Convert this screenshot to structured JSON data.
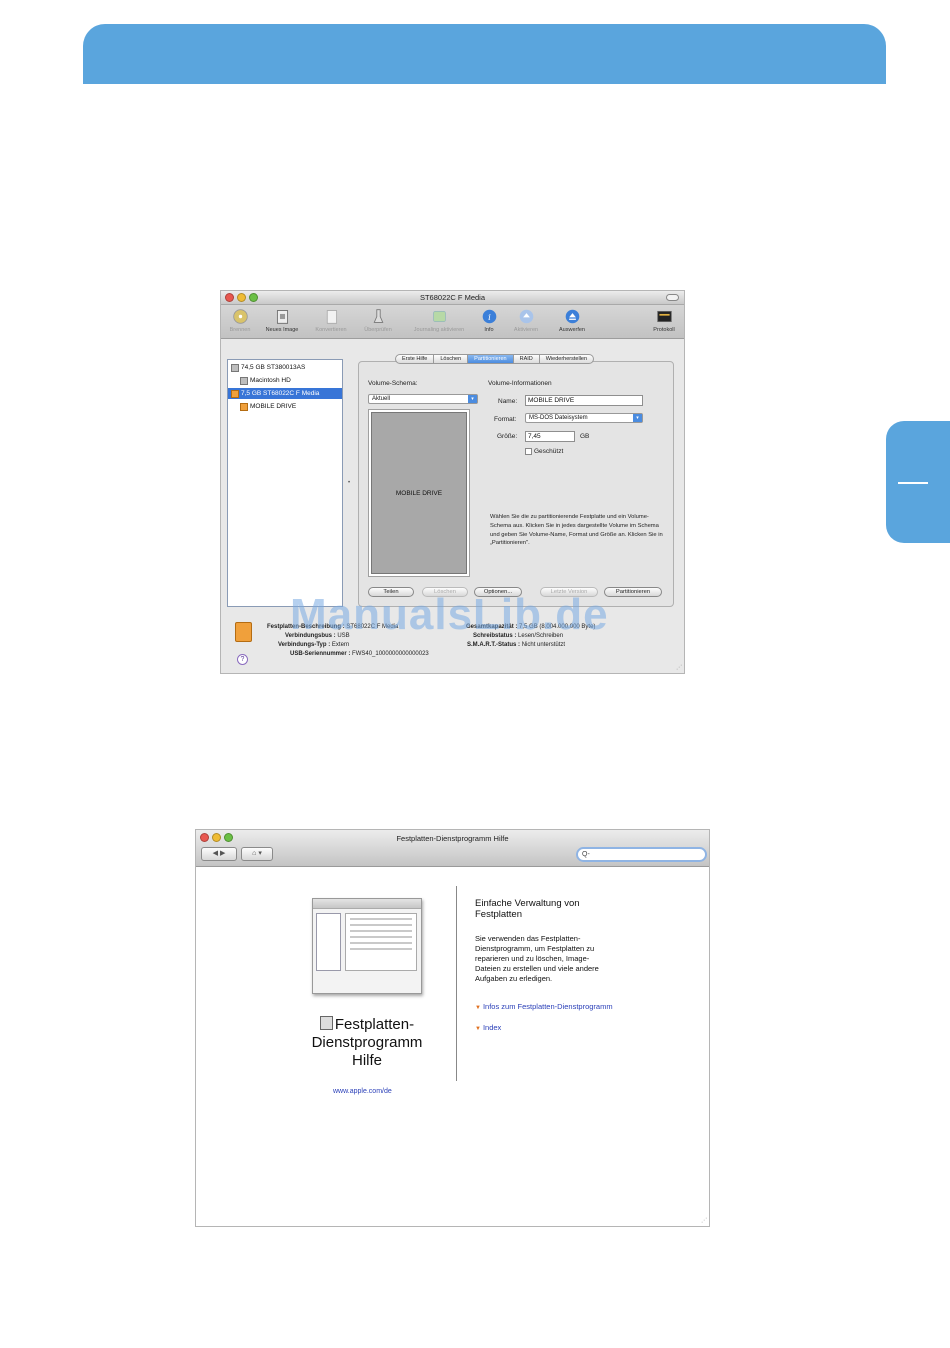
{
  "page": {
    "accent_color": "#5aa5dd"
  },
  "disk_utility": {
    "title": "ST68022C F Media",
    "toolbar": [
      {
        "label": "Brennen",
        "icon": "burn-icon",
        "enabled": false
      },
      {
        "label": "Neues Image",
        "icon": "new-image-icon",
        "enabled": true
      },
      {
        "label": "Konvertieren",
        "icon": "convert-icon",
        "enabled": false
      },
      {
        "label": "Überprüfen",
        "icon": "verify-icon",
        "enabled": false
      },
      {
        "label": "Journaling aktivieren",
        "icon": "journaling-icon",
        "enabled": false
      },
      {
        "label": "Info",
        "icon": "info-icon",
        "enabled": true
      },
      {
        "label": "Aktivieren",
        "icon": "mount-icon",
        "enabled": false
      },
      {
        "label": "Auswerfen",
        "icon": "eject-icon",
        "enabled": true
      },
      {
        "label": "Protokoll",
        "icon": "log-icon",
        "enabled": true
      }
    ],
    "sidebar": [
      {
        "label": "74,5 GB ST380013AS",
        "level": 0,
        "selected": false
      },
      {
        "label": "Macintosh HD",
        "level": 1,
        "selected": false
      },
      {
        "label": "7,5 GB ST68022C F Media",
        "level": 0,
        "selected": true
      },
      {
        "label": "MOBILE DRIVE",
        "level": 1,
        "selected": false
      }
    ],
    "tabs": [
      "Erste Hilfe",
      "Löschen",
      "Partitionieren",
      "RAID",
      "Wiederherstellen"
    ],
    "active_tab": "Partitionieren",
    "volume_scheme_label": "Volume-Schema:",
    "volume_scheme_value": "Aktuell",
    "volume_info_label": "Volume-Informationen",
    "name_label": "Name:",
    "name_value": "MOBILE DRIVE",
    "format_label": "Format:",
    "format_value": "MS-DOS Dateisystem",
    "size_label": "Größe:",
    "size_value": "7,45",
    "size_unit": "GB",
    "locked_label": "Geschützt",
    "scheme_volume_name": "MOBILE DRIVE",
    "info_text": "Wählen Sie die zu partitionierende Festplatte und ein Volume-Schema aus. Klicken Sie in jedes dargestellte Volume im Schema und geben Sie Volume-Name, Format und Größe an. Klicken Sie in „Partitionieren\".",
    "buttons": {
      "split": "Teilen",
      "delete": "Löschen",
      "options": "Optionen...",
      "revert": "Letzte Version",
      "partition": "Partitionieren"
    },
    "details": {
      "description_key": "Festplatten-Beschreibung :",
      "description_val": "ST68022C F Media",
      "connection_bus_key": "Verbindungsbus :",
      "connection_bus_val": "USB",
      "connection_type_key": "Verbindungs-Typ :",
      "connection_type_val": "Extern",
      "serial_key": "USB-Seriennummer :",
      "serial_val": "FWS40_1000000000000023",
      "capacity_key": "Gesamtkapazität :",
      "capacity_val": "7,5 GB (8.004.000.000 Byte)",
      "write_status_key": "Schreibstatus :",
      "write_status_val": "Lesen/Schreiben",
      "smart_key": "S.M.A.R.T.-Status :",
      "smart_val": "Nicht unterstützt"
    }
  },
  "watermark": "ManualsLib.de",
  "help_viewer": {
    "title": "Festplatten-Dienstprogramm Hilfe",
    "search_placeholder": "Q-",
    "book_title": "Festplatten-Dienstprogramm Hilfe",
    "apple_link": "www.apple.com/de",
    "heading": "Einfache Verwaltung von Festplatten",
    "paragraph": "Sie verwenden das Festplatten-Dienstprogramm, um Festplatten zu reparieren und zu löschen, Image-Dateien zu erstellen und viele andere Aufgaben zu erledigen.",
    "links": [
      "Infos zum Festplatten-Dienstprogramm",
      "Index"
    ]
  }
}
